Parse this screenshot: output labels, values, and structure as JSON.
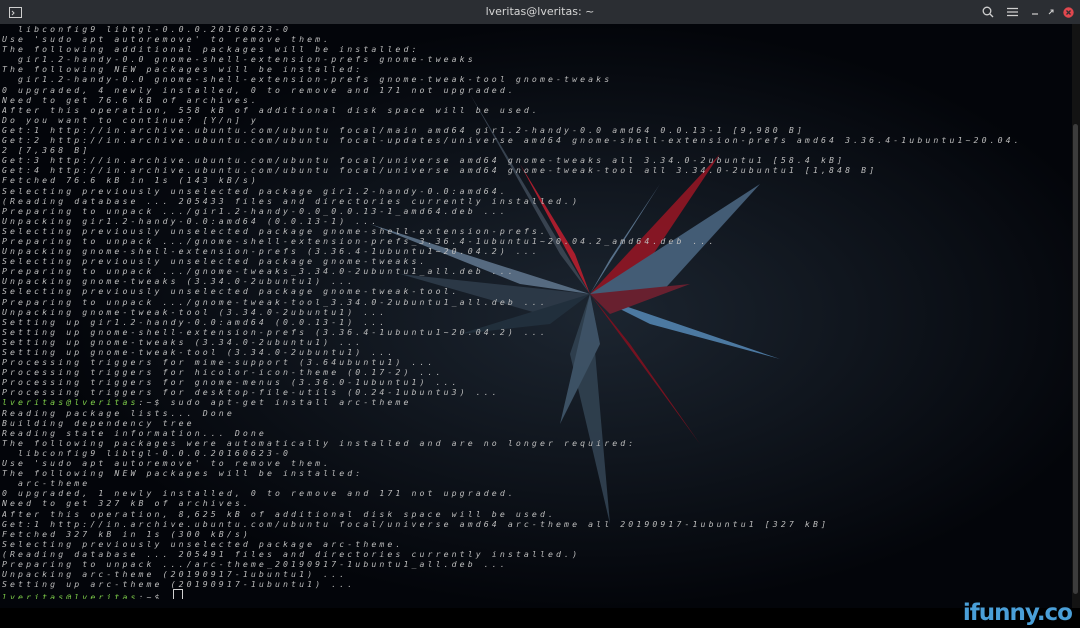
{
  "window": {
    "title": "lveritas@lveritas: ~"
  },
  "titlebar": {
    "icons": [
      "terminal-icon",
      "search-icon",
      "menu-icon",
      "minimize-icon",
      "maximize-icon",
      "close-icon"
    ]
  },
  "terminal": {
    "lines": [
      {
        "t": "  libconfig9 libtgl-0.0.0.20160623-0"
      },
      {
        "t": "Use 'sudo apt autoremove' to remove them."
      },
      {
        "t": "The following additional packages will be installed:"
      },
      {
        "t": "  gir1.2-handy-0.0 gnome-shell-extension-prefs gnome-tweaks"
      },
      {
        "t": "The following NEW packages will be installed:"
      },
      {
        "t": "  gir1.2-handy-0.0 gnome-shell-extension-prefs gnome-tweak-tool gnome-tweaks"
      },
      {
        "t": "0 upgraded, 4 newly installed, 0 to remove and 171 not upgraded."
      },
      {
        "t": "Need to get 76.6 kB of archives."
      },
      {
        "t": "After this operation, 558 kB of additional disk space will be used."
      },
      {
        "t": "Do you want to continue? [Y/n] y"
      },
      {
        "t": "Get:1 http://in.archive.ubuntu.com/ubuntu focal/main amd64 gir1.2-handy-0.0 amd64 0.0.13-1 [9,980 B]"
      },
      {
        "t": "Get:2 http://in.archive.ubuntu.com/ubuntu focal-updates/universe amd64 gnome-shell-extension-prefs amd64 3.36.4-1ubuntu1~20.04."
      },
      {
        "t": "2 [7,368 B]"
      },
      {
        "t": "Get:3 http://in.archive.ubuntu.com/ubuntu focal/universe amd64 gnome-tweaks all 3.34.0-2ubuntu1 [58.4 kB]"
      },
      {
        "t": "Get:4 http://in.archive.ubuntu.com/ubuntu focal/universe amd64 gnome-tweak-tool all 3.34.0-2ubuntu1 [1,848 B]"
      },
      {
        "t": "Fetched 76.6 kB in 1s (143 kB/s)"
      },
      {
        "t": "Selecting previously unselected package gir1.2-handy-0.0:amd64."
      },
      {
        "t": "(Reading database ... 205433 files and directories currently installed.)"
      },
      {
        "t": "Preparing to unpack .../gir1.2-handy-0.0_0.0.13-1_amd64.deb ..."
      },
      {
        "t": "Unpacking gir1.2-handy-0.0:amd64 (0.0.13-1) ..."
      },
      {
        "t": "Selecting previously unselected package gnome-shell-extension-prefs."
      },
      {
        "t": "Preparing to unpack .../gnome-shell-extension-prefs_3.36.4-1ubuntu1~20.04.2_amd64.deb ..."
      },
      {
        "t": "Unpacking gnome-shell-extension-prefs (3.36.4-1ubuntu1~20.04.2) ..."
      },
      {
        "t": "Selecting previously unselected package gnome-tweaks."
      },
      {
        "t": "Preparing to unpack .../gnome-tweaks_3.34.0-2ubuntu1_all.deb ..."
      },
      {
        "t": "Unpacking gnome-tweaks (3.34.0-2ubuntu1) ..."
      },
      {
        "t": "Selecting previously unselected package gnome-tweak-tool."
      },
      {
        "t": "Preparing to unpack .../gnome-tweak-tool_3.34.0-2ubuntu1_all.deb ..."
      },
      {
        "t": "Unpacking gnome-tweak-tool (3.34.0-2ubuntu1) ..."
      },
      {
        "t": "Setting up gir1.2-handy-0.0:amd64 (0.0.13-1) ..."
      },
      {
        "t": "Setting up gnome-shell-extension-prefs (3.36.4-1ubuntu1~20.04.2) ..."
      },
      {
        "t": "Setting up gnome-tweaks (3.34.0-2ubuntu1) ..."
      },
      {
        "t": "Setting up gnome-tweak-tool (3.34.0-2ubuntu1) ..."
      },
      {
        "t": "Processing triggers for mime-support (3.64ubuntu1) ..."
      },
      {
        "t": "Processing triggers for hicolor-icon-theme (0.17-2) ..."
      },
      {
        "t": "Processing triggers for gnome-menus (3.36.0-1ubuntu1) ..."
      },
      {
        "t": "Processing triggers for desktop-file-utils (0.24-1ubuntu3) ..."
      },
      {
        "p": "lveritas@lveritas",
        "t": ":~$ sudo apt-get install arc-theme"
      },
      {
        "t": "Reading package lists... Done"
      },
      {
        "t": "Building dependency tree"
      },
      {
        "t": "Reading state information... Done"
      },
      {
        "t": "The following packages were automatically installed and are no longer required:"
      },
      {
        "t": "  libconfig9 libtgl-0.0.0.20160623-0"
      },
      {
        "t": "Use 'sudo apt autoremove' to remove them."
      },
      {
        "t": "The following NEW packages will be installed:"
      },
      {
        "t": "  arc-theme"
      },
      {
        "t": "0 upgraded, 1 newly installed, 0 to remove and 171 not upgraded."
      },
      {
        "t": "Need to get 327 kB of archives."
      },
      {
        "t": "After this operation, 8,625 kB of additional disk space will be used."
      },
      {
        "t": "Get:1 http://in.archive.ubuntu.com/ubuntu focal/universe amd64 arc-theme all 20190917-1ubuntu1 [327 kB]"
      },
      {
        "t": "Fetched 327 kB in 1s (300 kB/s)"
      },
      {
        "t": "Selecting previously unselected package arc-theme."
      },
      {
        "t": "(Reading database ... 205491 files and directories currently installed.)"
      },
      {
        "t": "Preparing to unpack .../arc-theme_20190917-1ubuntu1_all.deb ..."
      },
      {
        "t": "Unpacking arc-theme (20190917-1ubuntu1) ..."
      },
      {
        "t": "Setting up arc-theme (20190917-1ubuntu1) ..."
      },
      {
        "p": "lveritas@lveritas",
        "t": ":~$ ",
        "cursor": true
      }
    ]
  },
  "watermark": {
    "text": "ifunny.co"
  },
  "colors": {
    "prompt": "#7fd04a",
    "text": "#bdbdbd",
    "titlebar": "#2b2e33",
    "close": "#e0474e",
    "watermark": "#4a9fd8"
  }
}
